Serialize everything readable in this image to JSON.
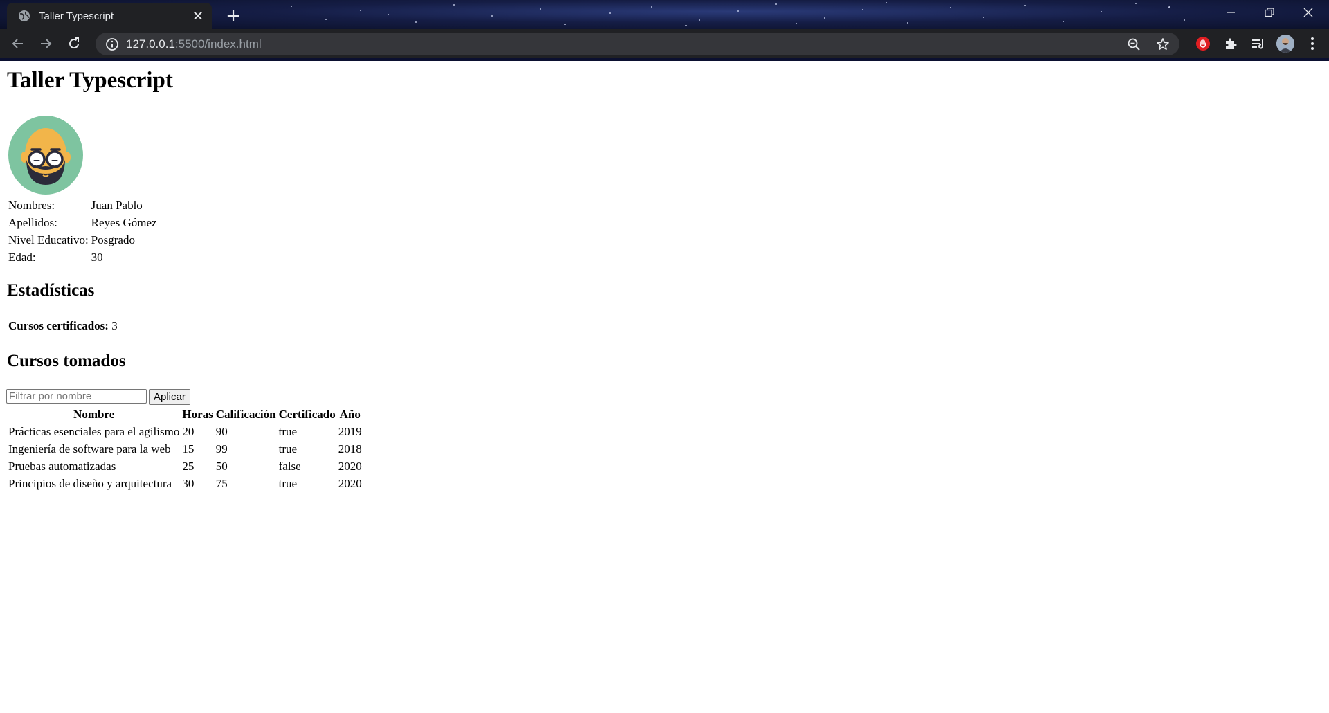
{
  "browser": {
    "tab_title": "Taller Typescript",
    "tab_close": "✕",
    "new_tab": "+",
    "url_host": "127.0.0.1",
    "url_path": ":5500/index.html",
    "icons": [
      "globe-icon",
      "back-arrow-icon",
      "forward-arrow-icon",
      "reload-icon",
      "info-icon",
      "zoom-icon",
      "star-icon",
      "stop-extension-icon",
      "puzzle-icon",
      "media-queue-icon",
      "profile-avatar",
      "kebab-menu-icon",
      "minimize-icon",
      "restore-icon",
      "close-window-icon"
    ]
  },
  "page": {
    "title": "Taller Typescript",
    "profile_image": "bald-bearded-man-avatar",
    "info": [
      {
        "label": "Nombres:",
        "value": "Juan Pablo"
      },
      {
        "label": "Apellidos:",
        "value": "Reyes Gómez"
      },
      {
        "label": "Nivel Educativo:",
        "value": "Posgrado"
      },
      {
        "label": "Edad:",
        "value": "30"
      }
    ],
    "stats_heading": "Estadísticas",
    "stats_label": "Cursos certificados:",
    "stats_value": "3",
    "courses_heading": "Cursos tomados",
    "filter_placeholder": "Filtrar por nombre",
    "apply_label": "Aplicar",
    "table": {
      "headers": [
        "Nombre",
        "Horas",
        "Calificación",
        "Certificado",
        "Año"
      ],
      "rows": [
        [
          "Prácticas esenciales para el agilismo",
          "20",
          "90",
          "true",
          "2019"
        ],
        [
          "Ingeniería de software para la web",
          "15",
          "99",
          "true",
          "2018"
        ],
        [
          "Pruebas automatizadas",
          "25",
          "50",
          "false",
          "2020"
        ],
        [
          "Principios de diseño y arquitectura",
          "30",
          "75",
          "true",
          "2020"
        ]
      ]
    }
  },
  "colors": {
    "chrome_bg": "#202124",
    "omnibox_bg": "#35363a",
    "avatar_bg": "#7ec4a0",
    "face": "#f2b54a",
    "beard": "#2b2b3a"
  }
}
